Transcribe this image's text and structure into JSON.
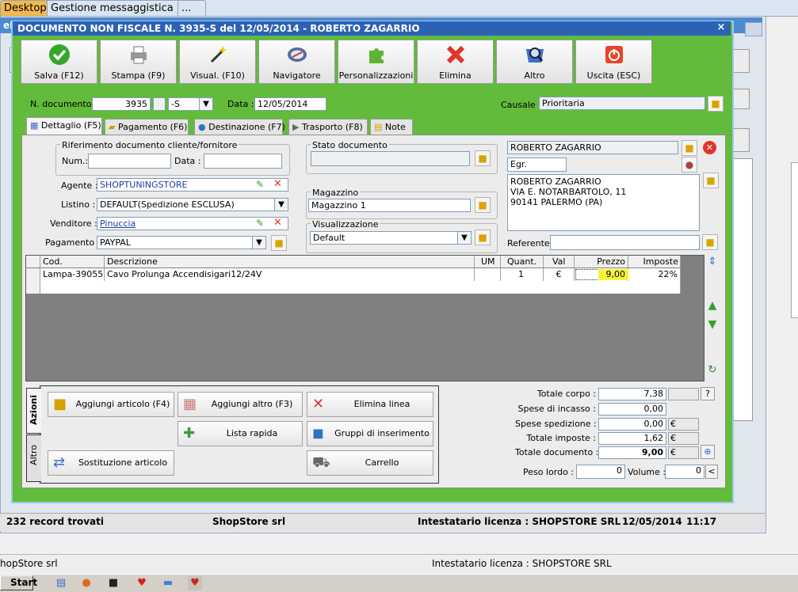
{
  "top_tabs": [
    "Desktop",
    "Gestione messaggistica",
    "..."
  ],
  "dialog": {
    "title": "DOCUMENTO NON FISCALE N. 3935-S del 12/05/2014 - ROBERTO ZAGARRIO",
    "bg_title_prefix": "eB",
    "close": "×"
  },
  "toolbar": [
    {
      "label": "Salva (F12)",
      "icon": "check-icon"
    },
    {
      "label": "Stampa (F9)",
      "icon": "printer-icon"
    },
    {
      "label": "Visual. (F10)",
      "icon": "magic-wand-icon"
    },
    {
      "label": "Navigatore",
      "icon": "compass-icon"
    },
    {
      "label": "Personalizzazioni",
      "icon": "puzzle-icon"
    },
    {
      "label": "Elimina",
      "icon": "x-icon"
    },
    {
      "label": "Altro",
      "icon": "magnifier-icon"
    },
    {
      "label": "Uscita (ESC)",
      "icon": "power-icon"
    }
  ],
  "header": {
    "n_documento_label": "N. documento :",
    "n_documento": "3935",
    "serie": "-S",
    "data_label": "Data :",
    "data": "12/05/2014",
    "causale_label": "Causale :",
    "causale": "Prioritaria"
  },
  "tabs": [
    "Dettaglio (F5)",
    "Pagamento (F6)",
    "Destinazione (F7)",
    "Trasporto (F8)",
    "Note"
  ],
  "riferimento": {
    "title": "Riferimento documento cliente/fornitore",
    "num_label": "Num.:",
    "num": "",
    "data_label": "Data :",
    "data": ""
  },
  "fields": {
    "agente_label": "Agente :",
    "agente": "SHOPTUNINGSTORE",
    "listino_label": "Listino :",
    "listino": "DEFAULT(Spedizione ESCLUSA)",
    "venditore_label": "Venditore :",
    "venditore": "Pinuccia",
    "pagamento_label": "Pagamento :",
    "pagamento": "PAYPAL"
  },
  "stato": {
    "title": "Stato documento",
    "value": ""
  },
  "magazzino": {
    "title": "Magazzino",
    "value": "Magazzino 1"
  },
  "visualizzazione": {
    "title": "Visualizzazione",
    "value": "Default"
  },
  "cliente": {
    "name": "ROBERTO ZAGARRIO",
    "title": "Egr.",
    "address": [
      "ROBERTO ZAGARRIO",
      "VIA E. NOTARBARTOLO, 11",
      "90141 PALERMO (PA)"
    ],
    "referente_label": "Referente",
    "referente": ""
  },
  "grid": {
    "columns": [
      "Cod.",
      "Descrizione",
      "UM",
      "Quant.",
      "Val",
      "Prezzo",
      "Imposte"
    ],
    "rows": [
      {
        "cod": "Lampa-39055",
        "descr": "Cavo Prolunga Accendisigari12/24V",
        "um": "",
        "quant": "1",
        "val": "€",
        "prezzo": "9,00",
        "imposte": "22%"
      }
    ]
  },
  "side_tabs": [
    "Azioni",
    "Altro"
  ],
  "actions": {
    "aggiungi_articolo": "Aggiungi articolo (F4)",
    "aggiungi_altro": "Aggiungi altro (F3)",
    "elimina_linea": "Elimina linea",
    "lista_rapida": "Lista rapida",
    "gruppi": "Gruppi di inserimento",
    "sostituzione": "Sostituzione articolo",
    "carrello": "Carrello"
  },
  "totals": {
    "totale_corpo_label": "Totale corpo :",
    "totale_corpo": "7,38",
    "spese_incasso_label": "Spese di incasso :",
    "spese_incasso": "0,00",
    "spese_spedizione_label": "Spese spedizione :",
    "spese_spedizione": "0,00",
    "totale_imposte_label": "Totale imposte :",
    "totale_imposte": "1,62",
    "totale_documento_label": "Totale documento :",
    "totale_documento": "9,00",
    "currency": "€",
    "help": "?",
    "peso_label": "Peso lordo :",
    "peso": "0",
    "volume_label": "Volume :",
    "volume": "0",
    "less": "<"
  },
  "status": {
    "records": "232 record trovati",
    "company": "ShopStore srl",
    "licenza": "Intestatario licenza : SHOPSTORE SRL",
    "date": "12/05/2014",
    "time": "11:17"
  },
  "status2": {
    "company": "hopStore srl",
    "licenza": "Intestatario licenza : SHOPSTORE SRL"
  },
  "taskbar": {
    "start": "Start"
  }
}
